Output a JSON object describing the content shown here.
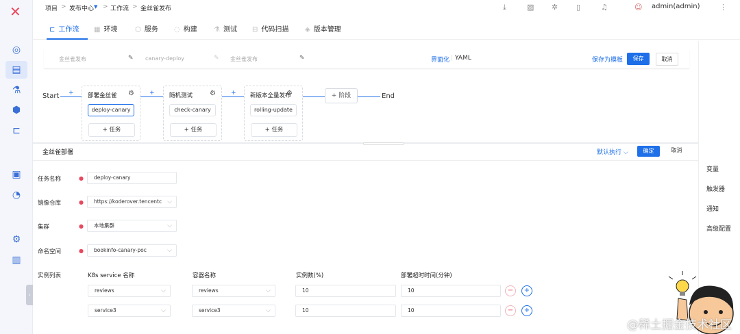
{
  "logo": "✕",
  "breadcrumb": {
    "project": "项目",
    "release_center": "发布中心",
    "workflow": "工作流",
    "current": "金丝雀发布"
  },
  "topbar": {
    "user": "admin(admin)"
  },
  "tabs": [
    {
      "label": "工作流"
    },
    {
      "label": "环境"
    },
    {
      "label": "服务"
    },
    {
      "label": "构建"
    },
    {
      "label": "测试"
    },
    {
      "label": "代码扫描"
    },
    {
      "label": "版本管理"
    }
  ],
  "workflow_header": {
    "display_name": "金丝雀发布",
    "key": "canary-deploy",
    "description": "金丝雀发布",
    "ui_mode": "界面化",
    "yaml_mode": "YAML",
    "save_as_template": "保存为模板",
    "save": "保存",
    "cancel": "取消"
  },
  "pipeline": {
    "start": "Start",
    "end": "End",
    "add_stage": "+ 阶段",
    "add_symbol": "+",
    "stages": [
      {
        "name": "部署金丝雀",
        "job": "deploy-canary",
        "add_task": "+ 任务"
      },
      {
        "name": "随机测试",
        "job": "check-canary",
        "add_task": "+ 任务"
      },
      {
        "name": "新版本全量发布",
        "job": "rolling-update",
        "add_task": "+ 任务"
      }
    ]
  },
  "panel": {
    "title": "金丝雀部署",
    "default_exec": "默认执行",
    "confirm": "确定",
    "cancel": "取消"
  },
  "form": {
    "task_name": {
      "label": "任务名称",
      "value": "deploy-canary"
    },
    "image_repo": {
      "label": "镜像仓库",
      "value": "https://koderover.tencentc"
    },
    "cluster": {
      "label": "集群",
      "value": "本地集群"
    },
    "namespace": {
      "label": "命名空间",
      "value": "bookinfo-canary-poc"
    },
    "instances": {
      "label": "实例列表",
      "headers": [
        "K8s service 名称",
        "容器名称",
        "实例数(%)",
        "部署超时时间(分钟)"
      ],
      "rows": [
        {
          "service": "reviews",
          "container": "reviews",
          "percent": "10",
          "timeout": "10"
        },
        {
          "service": "service3",
          "container": "service3",
          "percent": "10",
          "timeout": "10"
        }
      ]
    }
  },
  "right_pane": [
    "变量",
    "触发器",
    "通知",
    "高级配置"
  ],
  "watermark": "@稀土掘金技术社区",
  "colors": {
    "primary": "#1e6fe8",
    "danger": "#e8485d",
    "sidebar": "#f4f6fb"
  }
}
